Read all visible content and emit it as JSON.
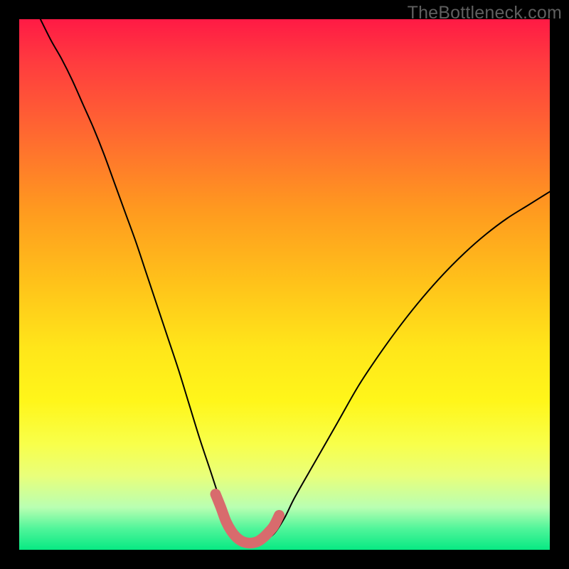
{
  "watermark": "TheBottleneck.com",
  "chart_data": {
    "type": "line",
    "title": "",
    "xlabel": "",
    "ylabel": "",
    "xlim": [
      0,
      100
    ],
    "ylim": [
      0,
      100
    ],
    "series": [
      {
        "name": "bottleneck-curve",
        "x": [
          4,
          6,
          8,
          10,
          12,
          14,
          16,
          18,
          20,
          22,
          24,
          26,
          28,
          30,
          32,
          34,
          36,
          38,
          40,
          41,
          42,
          43,
          44,
          45,
          46,
          48,
          50,
          52,
          56,
          60,
          64,
          68,
          72,
          76,
          80,
          84,
          88,
          92,
          96,
          100
        ],
        "values": [
          100,
          96,
          92.5,
          88.5,
          84,
          79.5,
          74.5,
          69,
          63.5,
          58,
          52,
          46,
          40,
          34,
          27.5,
          21,
          15,
          9,
          4,
          2.5,
          1.7,
          1.3,
          1.2,
          1.3,
          1.7,
          3,
          6,
          10,
          17,
          24,
          31,
          37,
          42.5,
          47.5,
          52,
          56,
          59.5,
          62.5,
          65,
          67.5
        ]
      },
      {
        "name": "optimal-zone",
        "x": [
          37,
          38,
          39,
          40,
          41,
          42,
          43,
          44,
          45,
          46,
          47,
          48,
          49
        ],
        "values": [
          10.5,
          8,
          5.3,
          3.5,
          2.3,
          1.6,
          1.3,
          1.3,
          1.6,
          2.3,
          3.3,
          4.5,
          6.5
        ]
      }
    ],
    "annotations": []
  }
}
